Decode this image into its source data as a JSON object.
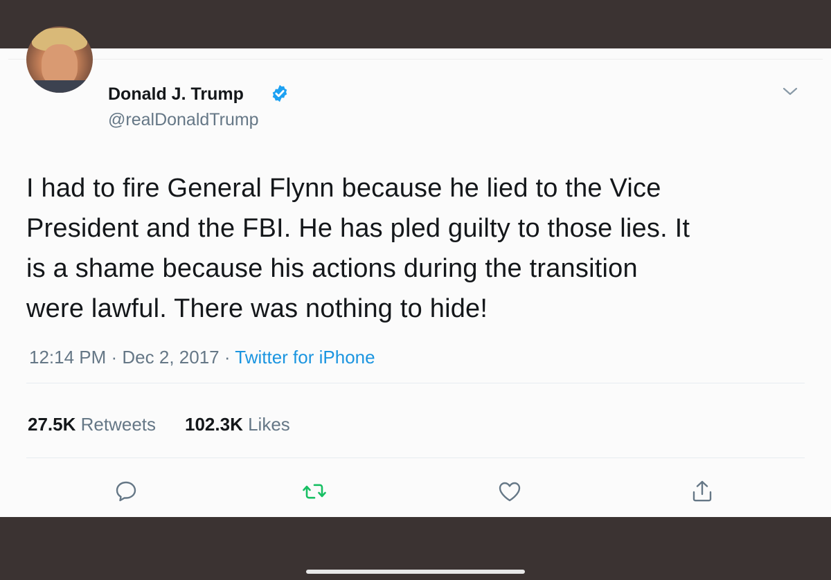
{
  "tweet": {
    "display_name": "Donald J. Trump",
    "handle": "@realDonaldTrump",
    "verified": true,
    "text_lines": [
      "I had to fire General Flynn because he lied to the Vice",
      "President and the FBI. He has pled guilty to those lies. It",
      "is a shame because his actions during the transition",
      "were lawful. There was nothing to hide!"
    ],
    "time": "12:14 PM",
    "separator": " · ",
    "date": "Dec 2, 2017",
    "source": "Twitter for iPhone",
    "retweets_count": "27.5K",
    "retweets_label": "Retweets",
    "likes_count": "102.3K",
    "likes_label": "Likes"
  },
  "icons": {
    "verified": "verified-badge-icon",
    "menu": "chevron-down-icon",
    "reply": "reply-icon",
    "retweet": "retweet-icon",
    "like": "heart-icon",
    "share": "share-icon"
  },
  "colors": {
    "verified_blue": "#1da1f2",
    "retweet_green": "#17bf63",
    "link_blue": "#1b95e0",
    "secondary_text": "#657786",
    "primary_text": "#14171a"
  }
}
